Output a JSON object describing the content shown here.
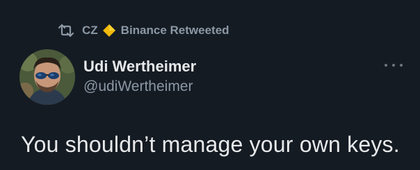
{
  "retweet": {
    "icon": "retweet-icon",
    "user": "CZ",
    "badge_icon": "binance-diamond-icon",
    "badge_color": "#f0b90b",
    "label": "Binance Retweeted"
  },
  "author": {
    "name": "Udi Wertheimer",
    "handle": "@udiWertheimer",
    "avatar_icon": "avatar-photo"
  },
  "more_icon": "more-icon",
  "tweet": {
    "text": "You shouldn’t manage your own keys."
  },
  "colors": {
    "background": "#151b23",
    "primary_text": "#e7e9ea",
    "secondary_text": "#8b98a5"
  }
}
